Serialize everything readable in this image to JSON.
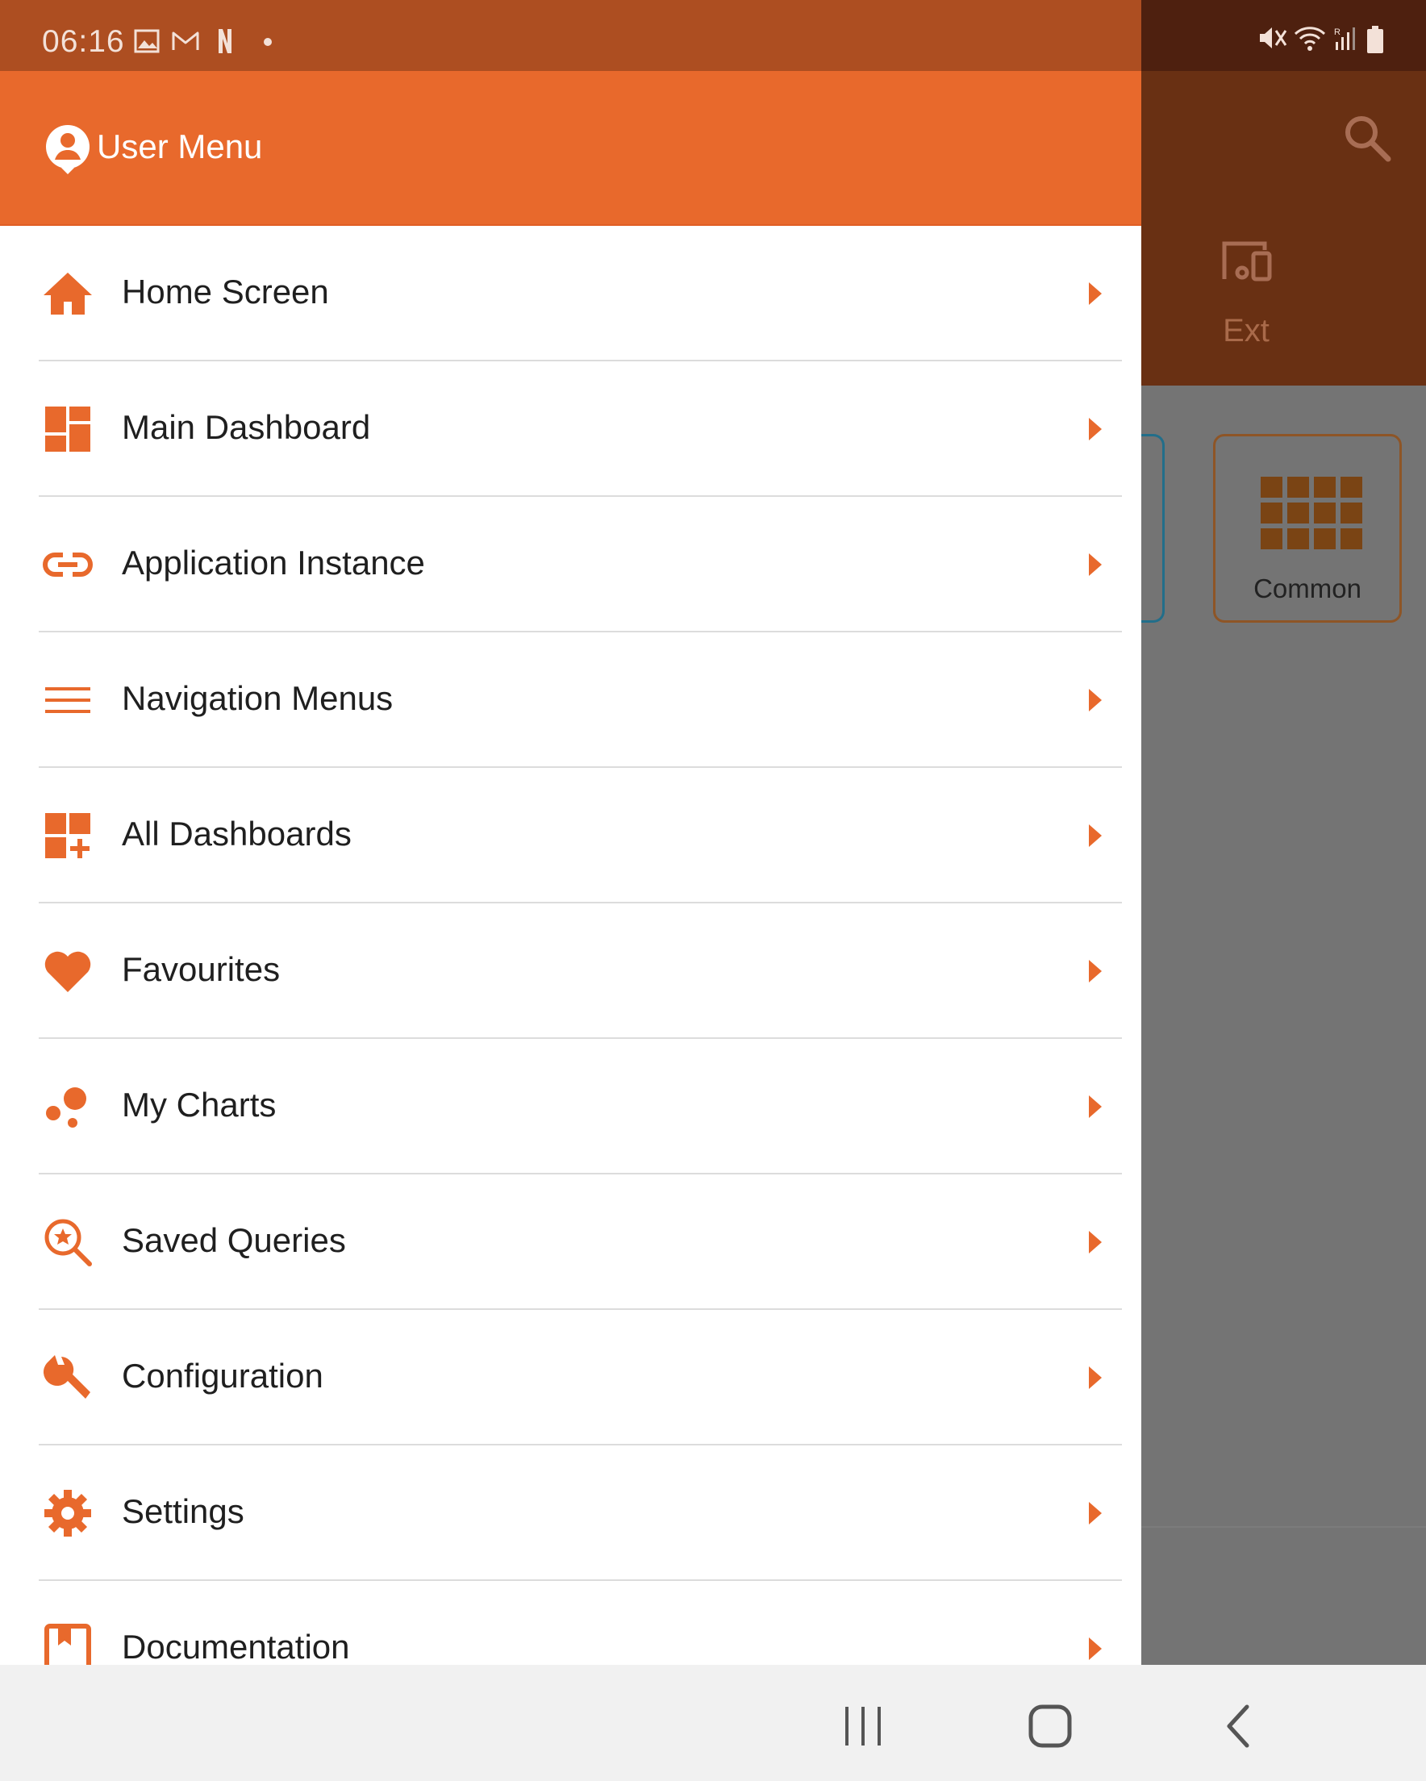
{
  "status_bar": {
    "time": "06:16",
    "left_icons": [
      "image-icon",
      "gmail-icon",
      "netflix-icon",
      "dot-icon"
    ],
    "right_icons": [
      "mute-icon",
      "wifi-icon",
      "signal-icon",
      "battery-icon"
    ],
    "signal_badge": "R"
  },
  "background_app": {
    "tab_label": "Ext",
    "card_label": "Common"
  },
  "drawer": {
    "title": "User Menu",
    "accent": "#e8692c",
    "items": [
      {
        "label": "Home Screen",
        "icon": "home-icon"
      },
      {
        "label": "Main Dashboard",
        "icon": "dashboard-icon"
      },
      {
        "label": "Application Instance",
        "icon": "link-icon"
      },
      {
        "label": "Navigation Menus",
        "icon": "menu-icon"
      },
      {
        "label": "All Dashboards",
        "icon": "dashboard-add-icon"
      },
      {
        "label": "Favourites",
        "icon": "heart-icon"
      },
      {
        "label": "My Charts",
        "icon": "bubble-chart-icon"
      },
      {
        "label": "Saved Queries",
        "icon": "search-star-icon"
      },
      {
        "label": "Configuration",
        "icon": "wrench-icon"
      },
      {
        "label": "Settings",
        "icon": "gear-icon"
      },
      {
        "label": "Documentation",
        "icon": "book-icon"
      }
    ]
  },
  "nav_bar": {
    "buttons": [
      "recent-apps-icon",
      "home-button-icon",
      "back-icon"
    ]
  }
}
